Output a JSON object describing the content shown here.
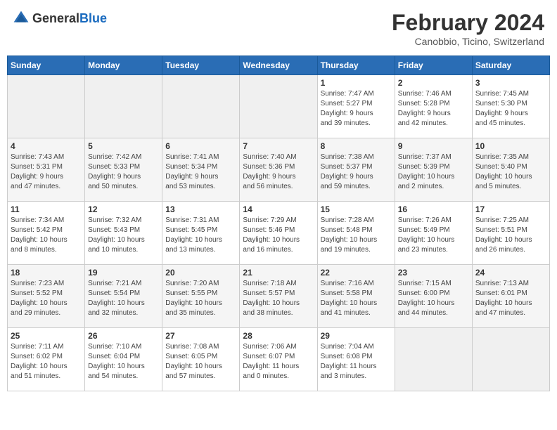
{
  "header": {
    "logo_general": "General",
    "logo_blue": "Blue",
    "title": "February 2024",
    "subtitle": "Canobbio, Ticino, Switzerland"
  },
  "weekdays": [
    "Sunday",
    "Monday",
    "Tuesday",
    "Wednesday",
    "Thursday",
    "Friday",
    "Saturday"
  ],
  "weeks": [
    [
      {
        "day": "",
        "info": ""
      },
      {
        "day": "",
        "info": ""
      },
      {
        "day": "",
        "info": ""
      },
      {
        "day": "",
        "info": ""
      },
      {
        "day": "1",
        "info": "Sunrise: 7:47 AM\nSunset: 5:27 PM\nDaylight: 9 hours\nand 39 minutes."
      },
      {
        "day": "2",
        "info": "Sunrise: 7:46 AM\nSunset: 5:28 PM\nDaylight: 9 hours\nand 42 minutes."
      },
      {
        "day": "3",
        "info": "Sunrise: 7:45 AM\nSunset: 5:30 PM\nDaylight: 9 hours\nand 45 minutes."
      }
    ],
    [
      {
        "day": "4",
        "info": "Sunrise: 7:43 AM\nSunset: 5:31 PM\nDaylight: 9 hours\nand 47 minutes."
      },
      {
        "day": "5",
        "info": "Sunrise: 7:42 AM\nSunset: 5:33 PM\nDaylight: 9 hours\nand 50 minutes."
      },
      {
        "day": "6",
        "info": "Sunrise: 7:41 AM\nSunset: 5:34 PM\nDaylight: 9 hours\nand 53 minutes."
      },
      {
        "day": "7",
        "info": "Sunrise: 7:40 AM\nSunset: 5:36 PM\nDaylight: 9 hours\nand 56 minutes."
      },
      {
        "day": "8",
        "info": "Sunrise: 7:38 AM\nSunset: 5:37 PM\nDaylight: 9 hours\nand 59 minutes."
      },
      {
        "day": "9",
        "info": "Sunrise: 7:37 AM\nSunset: 5:39 PM\nDaylight: 10 hours\nand 2 minutes."
      },
      {
        "day": "10",
        "info": "Sunrise: 7:35 AM\nSunset: 5:40 PM\nDaylight: 10 hours\nand 5 minutes."
      }
    ],
    [
      {
        "day": "11",
        "info": "Sunrise: 7:34 AM\nSunset: 5:42 PM\nDaylight: 10 hours\nand 8 minutes."
      },
      {
        "day": "12",
        "info": "Sunrise: 7:32 AM\nSunset: 5:43 PM\nDaylight: 10 hours\nand 10 minutes."
      },
      {
        "day": "13",
        "info": "Sunrise: 7:31 AM\nSunset: 5:45 PM\nDaylight: 10 hours\nand 13 minutes."
      },
      {
        "day": "14",
        "info": "Sunrise: 7:29 AM\nSunset: 5:46 PM\nDaylight: 10 hours\nand 16 minutes."
      },
      {
        "day": "15",
        "info": "Sunrise: 7:28 AM\nSunset: 5:48 PM\nDaylight: 10 hours\nand 19 minutes."
      },
      {
        "day": "16",
        "info": "Sunrise: 7:26 AM\nSunset: 5:49 PM\nDaylight: 10 hours\nand 23 minutes."
      },
      {
        "day": "17",
        "info": "Sunrise: 7:25 AM\nSunset: 5:51 PM\nDaylight: 10 hours\nand 26 minutes."
      }
    ],
    [
      {
        "day": "18",
        "info": "Sunrise: 7:23 AM\nSunset: 5:52 PM\nDaylight: 10 hours\nand 29 minutes."
      },
      {
        "day": "19",
        "info": "Sunrise: 7:21 AM\nSunset: 5:54 PM\nDaylight: 10 hours\nand 32 minutes."
      },
      {
        "day": "20",
        "info": "Sunrise: 7:20 AM\nSunset: 5:55 PM\nDaylight: 10 hours\nand 35 minutes."
      },
      {
        "day": "21",
        "info": "Sunrise: 7:18 AM\nSunset: 5:57 PM\nDaylight: 10 hours\nand 38 minutes."
      },
      {
        "day": "22",
        "info": "Sunrise: 7:16 AM\nSunset: 5:58 PM\nDaylight: 10 hours\nand 41 minutes."
      },
      {
        "day": "23",
        "info": "Sunrise: 7:15 AM\nSunset: 6:00 PM\nDaylight: 10 hours\nand 44 minutes."
      },
      {
        "day": "24",
        "info": "Sunrise: 7:13 AM\nSunset: 6:01 PM\nDaylight: 10 hours\nand 47 minutes."
      }
    ],
    [
      {
        "day": "25",
        "info": "Sunrise: 7:11 AM\nSunset: 6:02 PM\nDaylight: 10 hours\nand 51 minutes."
      },
      {
        "day": "26",
        "info": "Sunrise: 7:10 AM\nSunset: 6:04 PM\nDaylight: 10 hours\nand 54 minutes."
      },
      {
        "day": "27",
        "info": "Sunrise: 7:08 AM\nSunset: 6:05 PM\nDaylight: 10 hours\nand 57 minutes."
      },
      {
        "day": "28",
        "info": "Sunrise: 7:06 AM\nSunset: 6:07 PM\nDaylight: 11 hours\nand 0 minutes."
      },
      {
        "day": "29",
        "info": "Sunrise: 7:04 AM\nSunset: 6:08 PM\nDaylight: 11 hours\nand 3 minutes."
      },
      {
        "day": "",
        "info": ""
      },
      {
        "day": "",
        "info": ""
      }
    ]
  ]
}
